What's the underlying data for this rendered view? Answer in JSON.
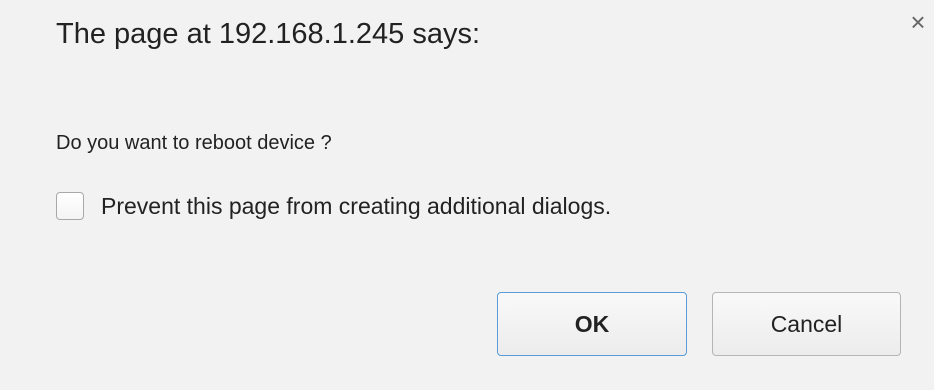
{
  "dialog": {
    "title": "The page at 192.168.1.245 says:",
    "message": "Do you want to reboot device ?",
    "prevent_label": "Prevent this page from creating additional dialogs.",
    "prevent_checked": false,
    "ok_label": "OK",
    "cancel_label": "Cancel",
    "close_glyph": "×",
    "accent_color": "#5a9bd8"
  }
}
